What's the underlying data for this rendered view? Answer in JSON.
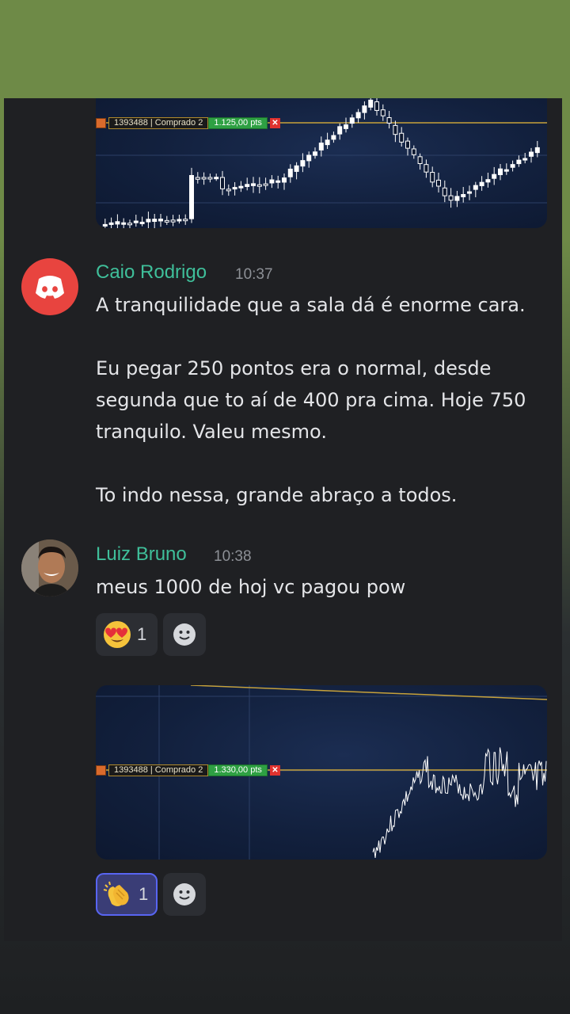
{
  "chart1": {
    "order_label": "1393488 | Comprado 2",
    "order_points": "1.125,00 pts",
    "close_glyph": "✕"
  },
  "messages": [
    {
      "author": "Caio Rodrigo",
      "time": "10:37",
      "avatar": "discord-logo-icon",
      "text": "A tranquilidade que a sala dá é enorme cara.\n\nEu pegar 250 pontos era o normal, desde\nsegunda que to aí de 400 pra cima. Hoje 750\ntranquilo.  Valeu mesmo.\n\nTo indo nessa, grande abraço a todos."
    },
    {
      "author": "Luiz Bruno",
      "time": "10:38",
      "avatar": "user-photo",
      "text": "meus 1000 de hoj vc pagou pow",
      "reactions": [
        {
          "emoji": "heart-eyes-emoji",
          "count": "1"
        }
      ]
    }
  ],
  "chart2": {
    "order_label": "1393488 | Comprado 2",
    "order_points": "1.330,00 pts",
    "close_glyph": "✕",
    "reactions": [
      {
        "emoji": "clapping-hands-emoji",
        "count": "1"
      }
    ]
  },
  "colors": {
    "accent_name": "#3fbf9a",
    "discord_red": "#e8443f",
    "top_bar": "#6e8a47"
  }
}
